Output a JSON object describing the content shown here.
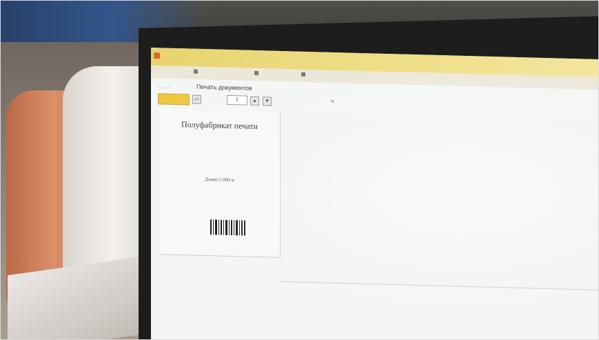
{
  "window": {
    "title": "",
    "form_title": "Печать документов"
  },
  "menu": {
    "items": [
      "",
      "",
      "",
      ""
    ]
  },
  "toolbar": {
    "print_label": "",
    "copies_value": "1",
    "nav_back": "←",
    "nav_forward": "→",
    "close_label": "✕"
  },
  "label_document": {
    "title": "Полуфабрикат печати",
    "subtitle": "",
    "length": "Длина 5 000 м",
    "date": ""
  },
  "colors": {
    "titlebar": "#f0df86",
    "print_button": "#f0c53b"
  },
  "icons": [
    "app-icon",
    "barcode-icon",
    "printer-icon",
    "close-icon"
  ]
}
